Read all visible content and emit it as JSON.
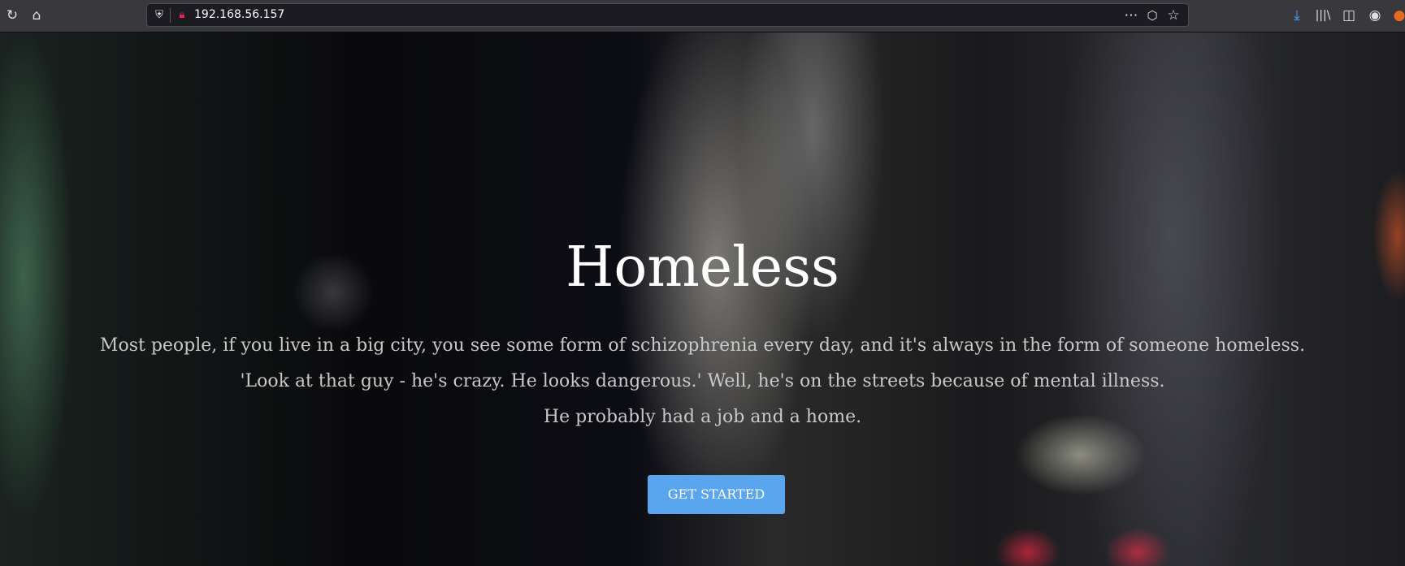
{
  "browser": {
    "url": "192.168.56.157",
    "icons": [
      "reload-icon",
      "home-icon",
      "shield-icon",
      "insecure-lock-icon",
      "more-icon",
      "pocket-icon",
      "star-icon",
      "download-icon",
      "library-icon",
      "sidebar-icon",
      "account-icon",
      "extension-icon"
    ],
    "download_color": "#45a1ff"
  },
  "hero": {
    "title": "Homeless",
    "lines": [
      "Most people, if you live in a big city, you see some form of schizophrenia every day, and it's always in the form of someone homeless.",
      "'Look at that guy - he's crazy. He looks dangerous.' Well, he's on the streets because of mental illness.",
      "He probably had a job and a home."
    ],
    "button_label": "GET STARTED",
    "button_color": "#5aa6ee"
  }
}
